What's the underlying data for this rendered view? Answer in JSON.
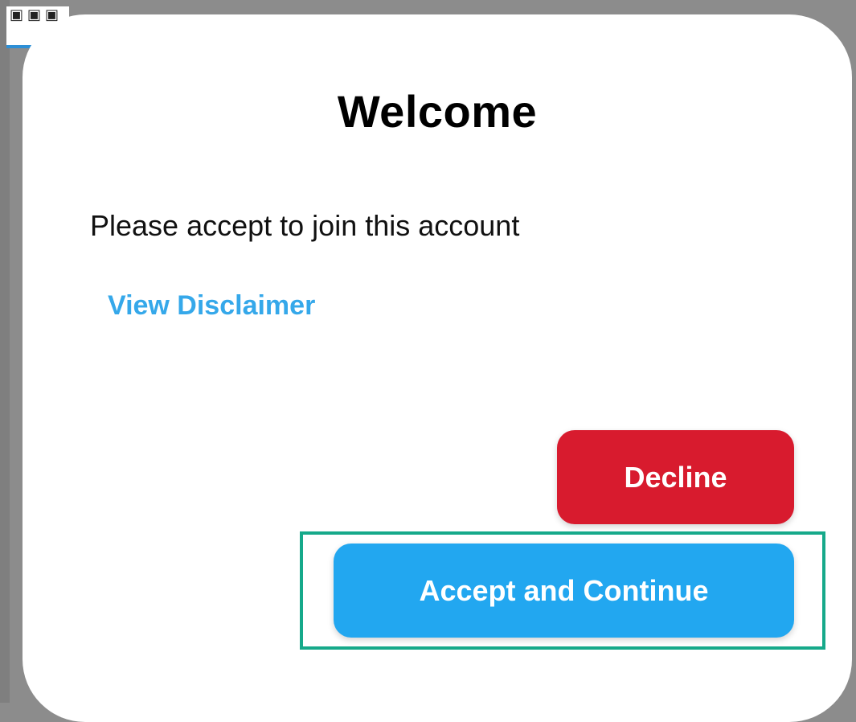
{
  "background": {
    "overlay_color": "#8c8c8c",
    "thumbnail_glyphs": [
      "▣",
      "▣",
      "▣"
    ]
  },
  "dialog": {
    "title": "Welcome",
    "message": "Please accept to join this account",
    "disclaimer_link": "View Disclaimer",
    "buttons": {
      "decline_label": "Decline",
      "accept_label": "Accept and Continue"
    }
  },
  "colors": {
    "link": "#35a8ea",
    "decline": "#d81b2e",
    "accept": "#22a7f0",
    "highlight": "#16a98a"
  }
}
